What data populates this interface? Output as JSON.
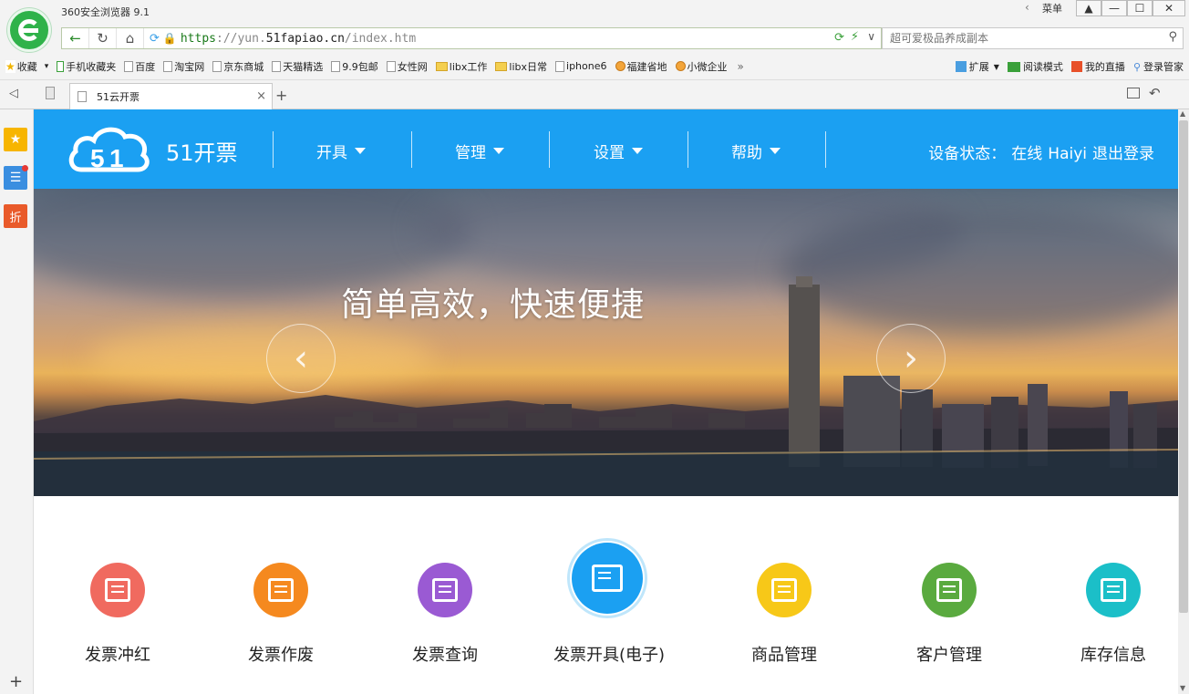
{
  "browser": {
    "app_title": "360安全浏览器 9.1",
    "menu_label": "菜单",
    "url_scheme": "https",
    "url_separator": "://yun.",
    "url_domain": "51fapiao.cn",
    "url_path": "/index.htm",
    "search_placeholder": "超可爱极品养成副本",
    "bookmarks": [
      {
        "label": "收藏",
        "icon": "star"
      },
      {
        "label": "手机收藏夹",
        "icon": "phone"
      },
      {
        "label": "百度",
        "icon": "page"
      },
      {
        "label": "淘宝网",
        "icon": "page"
      },
      {
        "label": "京东商城",
        "icon": "page"
      },
      {
        "label": "天猫精选",
        "icon": "page"
      },
      {
        "label": "9.9包邮",
        "icon": "page"
      },
      {
        "label": "女性网",
        "icon": "page"
      },
      {
        "label": "libx工作",
        "icon": "folder"
      },
      {
        "label": "libx日常",
        "icon": "folder"
      },
      {
        "label": "iphone6",
        "icon": "page"
      },
      {
        "label": "福建省地",
        "icon": "globe"
      },
      {
        "label": "小微企业",
        "icon": "globe"
      }
    ],
    "bookmark_right": {
      "extensions": "扩展",
      "reading_mode": "阅读模式",
      "live": "我的直播",
      "login_manager": "登录管家"
    },
    "tab_title": "51云开票",
    "sidebar_badge": "折"
  },
  "site": {
    "brand": "51开票",
    "nav": [
      {
        "label": "开具"
      },
      {
        "label": "管理"
      },
      {
        "label": "设置"
      },
      {
        "label": "帮助"
      }
    ],
    "status_label": "设备状态：",
    "status_value": "在线",
    "user": "Haiyi",
    "logout": "退出登录",
    "banner_slogan": "简单高效，快速便捷",
    "features": [
      {
        "label": "发票冲红",
        "color": "#f06a5f",
        "icon": "invoice-check-icon"
      },
      {
        "label": "发票作废",
        "color": "#f5891f",
        "icon": "invoice-cut-icon"
      },
      {
        "label": "发票查询",
        "color": "#9a5ad3",
        "icon": "invoice-search-icon"
      },
      {
        "label": "发票开具(电子)",
        "color": "#1ba0f2",
        "icon": "invoice-mobile-icon"
      },
      {
        "label": "商品管理",
        "color": "#f7c818",
        "icon": "basket-icon"
      },
      {
        "label": "客户管理",
        "color": "#5aaa3f",
        "icon": "customer-icon"
      },
      {
        "label": "库存信息",
        "color": "#1bbfc8",
        "icon": "warehouse-icon"
      }
    ]
  }
}
